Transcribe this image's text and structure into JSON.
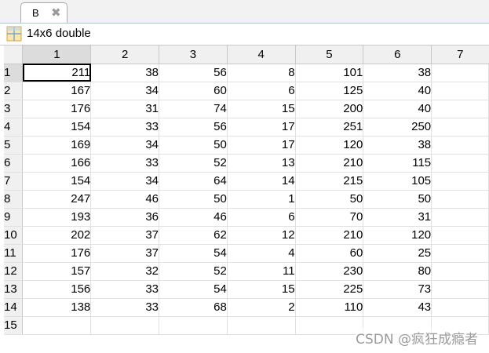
{
  "tab": {
    "label": "B",
    "close_symbol": "✖"
  },
  "info": {
    "dims": "14x6 double",
    "icon": "variable-grid-icon"
  },
  "columns": [
    "1",
    "2",
    "3",
    "4",
    "5",
    "6",
    "7"
  ],
  "rows": [
    {
      "label": "1",
      "values": [
        "211",
        "38",
        "56",
        "8",
        "101",
        "38",
        ""
      ]
    },
    {
      "label": "2",
      "values": [
        "167",
        "34",
        "60",
        "6",
        "125",
        "40",
        ""
      ]
    },
    {
      "label": "3",
      "values": [
        "176",
        "31",
        "74",
        "15",
        "200",
        "40",
        ""
      ]
    },
    {
      "label": "4",
      "values": [
        "154",
        "33",
        "56",
        "17",
        "251",
        "250",
        ""
      ]
    },
    {
      "label": "5",
      "values": [
        "169",
        "34",
        "50",
        "17",
        "120",
        "38",
        ""
      ]
    },
    {
      "label": "6",
      "values": [
        "166",
        "33",
        "52",
        "13",
        "210",
        "115",
        ""
      ]
    },
    {
      "label": "7",
      "values": [
        "154",
        "34",
        "64",
        "14",
        "215",
        "105",
        ""
      ]
    },
    {
      "label": "8",
      "values": [
        "247",
        "46",
        "50",
        "1",
        "50",
        "50",
        ""
      ]
    },
    {
      "label": "9",
      "values": [
        "193",
        "36",
        "46",
        "6",
        "70",
        "31",
        ""
      ]
    },
    {
      "label": "10",
      "values": [
        "202",
        "37",
        "62",
        "12",
        "210",
        "120",
        ""
      ]
    },
    {
      "label": "11",
      "values": [
        "176",
        "37",
        "54",
        "4",
        "60",
        "25",
        ""
      ]
    },
    {
      "label": "12",
      "values": [
        "157",
        "32",
        "52",
        "11",
        "230",
        "80",
        ""
      ]
    },
    {
      "label": "13",
      "values": [
        "156",
        "33",
        "54",
        "15",
        "225",
        "73",
        ""
      ]
    },
    {
      "label": "14",
      "values": [
        "138",
        "33",
        "68",
        "2",
        "110",
        "43",
        ""
      ]
    },
    {
      "label": "15",
      "values": [
        "",
        "",
        "",
        "",
        "",
        "",
        ""
      ]
    }
  ],
  "watermark": "CSDN @疯狂成瘾者",
  "colors": {
    "header_bg": "#f0f0f0",
    "selected_header_bg": "#dcdcdc",
    "grid_line": "#e0e0e0"
  }
}
